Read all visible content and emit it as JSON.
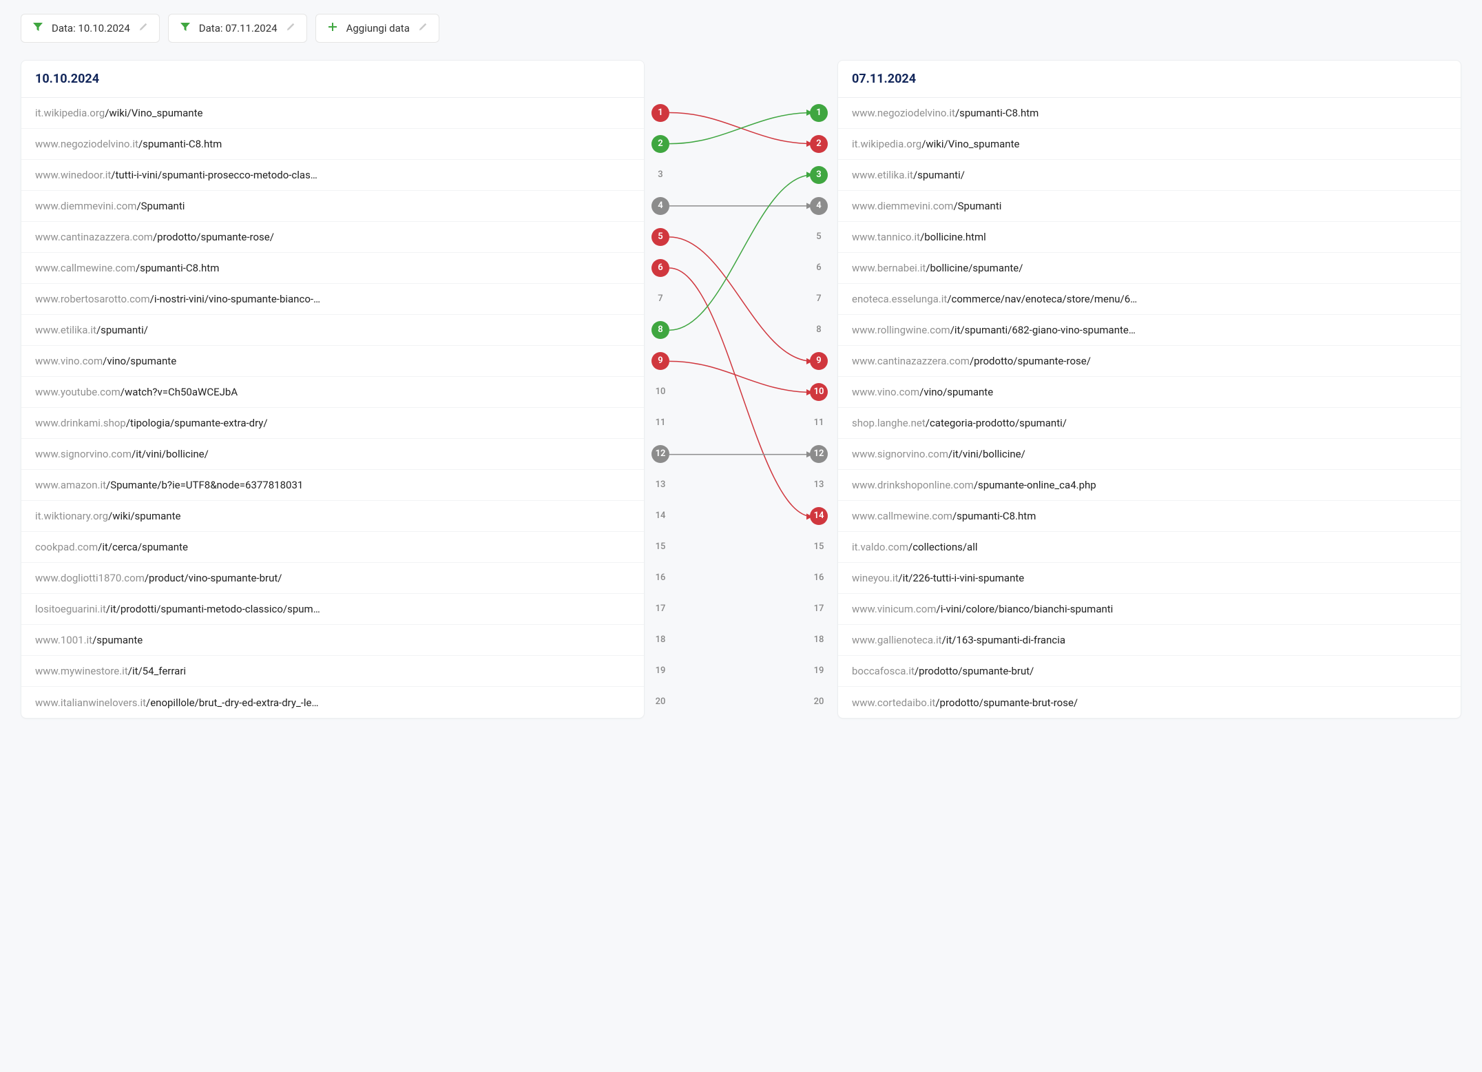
{
  "filters": {
    "date1_label": "Data: 10.10.2024",
    "date2_label": "Data: 07.11.2024",
    "add_label": "Aggiungi data"
  },
  "left": {
    "title": "10.10.2024",
    "rows": [
      {
        "domain": "it.wikipedia.org",
        "path": "/wiki/Vino_spumante"
      },
      {
        "domain": "www.negoziodelvino.it",
        "path": "/spumanti-C8.htm"
      },
      {
        "domain": "www.winedoor.it",
        "path": "/tutti-i-vini/spumanti-prosecco-metodo-clas…"
      },
      {
        "domain": "www.diemmevini.com",
        "path": "/Spumanti"
      },
      {
        "domain": "www.cantinazazzera.com",
        "path": "/prodotto/spumante-rose/"
      },
      {
        "domain": "www.callmewine.com",
        "path": "/spumanti-C8.htm"
      },
      {
        "domain": "www.robertosarotto.com",
        "path": "/i-nostri-vini/vino-spumante-bianco-…"
      },
      {
        "domain": "www.etilika.it",
        "path": "/spumanti/"
      },
      {
        "domain": "www.vino.com",
        "path": "/vino/spumante"
      },
      {
        "domain": "www.youtube.com",
        "path": "/watch?v=Ch50aWCEJbA"
      },
      {
        "domain": "www.drinkami.shop",
        "path": "/tipologia/spumante-extra-dry/"
      },
      {
        "domain": "www.signorvino.com",
        "path": "/it/vini/bollicine/"
      },
      {
        "domain": "www.amazon.it",
        "path": "/Spumante/b?ie=UTF8&node=6377818031"
      },
      {
        "domain": "it.wiktionary.org",
        "path": "/wiki/spumante"
      },
      {
        "domain": "cookpad.com",
        "path": "/it/cerca/spumante"
      },
      {
        "domain": "www.dogliotti1870.com",
        "path": "/product/vino-spumante-brut/"
      },
      {
        "domain": "lositoeguarini.it",
        "path": "/it/prodotti/spumanti-metodo-classico/spum…"
      },
      {
        "domain": "www.1001.it",
        "path": "/spumante"
      },
      {
        "domain": "www.mywinestore.it",
        "path": "/it/54_ferrari"
      },
      {
        "domain": "www.italianwinelovers.it",
        "path": "/enopillole/brut_-dry-ed-extra-dry_-le…"
      }
    ]
  },
  "right": {
    "title": "07.11.2024",
    "rows": [
      {
        "domain": "www.negoziodelvino.it",
        "path": "/spumanti-C8.htm"
      },
      {
        "domain": "it.wikipedia.org",
        "path": "/wiki/Vino_spumante"
      },
      {
        "domain": "www.etilika.it",
        "path": "/spumanti/"
      },
      {
        "domain": "www.diemmevini.com",
        "path": "/Spumanti"
      },
      {
        "domain": "www.tannico.it",
        "path": "/bollicine.html"
      },
      {
        "domain": "www.bernabei.it",
        "path": "/bollicine/spumante/"
      },
      {
        "domain": "enoteca.esselunga.it",
        "path": "/commerce/nav/enoteca/store/menu/6…"
      },
      {
        "domain": "www.rollingwine.com",
        "path": "/it/spumanti/682-giano-vino-spumante…"
      },
      {
        "domain": "www.cantinazazzera.com",
        "path": "/prodotto/spumante-rose/"
      },
      {
        "domain": "www.vino.com",
        "path": "/vino/spumante"
      },
      {
        "domain": "shop.langhe.net",
        "path": "/categoria-prodotto/spumanti/"
      },
      {
        "domain": "www.signorvino.com",
        "path": "/it/vini/bollicine/"
      },
      {
        "domain": "www.drinkshoponline.com",
        "path": "/spumante-online_ca4.php"
      },
      {
        "domain": "www.callmewine.com",
        "path": "/spumanti-C8.htm"
      },
      {
        "domain": "it.valdo.com",
        "path": "/collections/all"
      },
      {
        "domain": "wineyou.it",
        "path": "/it/226-tutti-i-vini-spumante"
      },
      {
        "domain": "www.vinicum.com",
        "path": "/i-vini/colore/bianco/bianchi-spumanti"
      },
      {
        "domain": "www.gallienoteca.it",
        "path": "/it/163-spumanti-di-francia"
      },
      {
        "domain": "boccafosca.it",
        "path": "/prodotto/spumante-brut/"
      },
      {
        "domain": "www.cortedaibo.it",
        "path": "/prodotto/spumante-brut-rose/"
      }
    ]
  },
  "badges": {
    "left": [
      {
        "n": "1",
        "c": "red"
      },
      {
        "n": "2",
        "c": "green"
      },
      {
        "n": "3",
        "c": "plain"
      },
      {
        "n": "4",
        "c": "gray"
      },
      {
        "n": "5",
        "c": "red"
      },
      {
        "n": "6",
        "c": "red"
      },
      {
        "n": "7",
        "c": "plain"
      },
      {
        "n": "8",
        "c": "green"
      },
      {
        "n": "9",
        "c": "red"
      },
      {
        "n": "10",
        "c": "plain"
      },
      {
        "n": "11",
        "c": "plain"
      },
      {
        "n": "12",
        "c": "gray"
      },
      {
        "n": "13",
        "c": "plain"
      },
      {
        "n": "14",
        "c": "plain"
      },
      {
        "n": "15",
        "c": "plain"
      },
      {
        "n": "16",
        "c": "plain"
      },
      {
        "n": "17",
        "c": "plain"
      },
      {
        "n": "18",
        "c": "plain"
      },
      {
        "n": "19",
        "c": "plain"
      },
      {
        "n": "20",
        "c": "plain"
      }
    ],
    "right": [
      {
        "n": "1",
        "c": "green"
      },
      {
        "n": "2",
        "c": "red"
      },
      {
        "n": "3",
        "c": "green"
      },
      {
        "n": "4",
        "c": "gray"
      },
      {
        "n": "5",
        "c": "plain"
      },
      {
        "n": "6",
        "c": "plain"
      },
      {
        "n": "7",
        "c": "plain"
      },
      {
        "n": "8",
        "c": "plain"
      },
      {
        "n": "9",
        "c": "red"
      },
      {
        "n": "10",
        "c": "red"
      },
      {
        "n": "11",
        "c": "plain"
      },
      {
        "n": "12",
        "c": "gray"
      },
      {
        "n": "13",
        "c": "plain"
      },
      {
        "n": "14",
        "c": "red"
      },
      {
        "n": "15",
        "c": "plain"
      },
      {
        "n": "16",
        "c": "plain"
      },
      {
        "n": "17",
        "c": "plain"
      },
      {
        "n": "18",
        "c": "plain"
      },
      {
        "n": "19",
        "c": "plain"
      },
      {
        "n": "20",
        "c": "plain"
      }
    ]
  },
  "connections": [
    {
      "from": 1,
      "to": 2,
      "c": "red"
    },
    {
      "from": 2,
      "to": 1,
      "c": "green"
    },
    {
      "from": 4,
      "to": 4,
      "c": "gray"
    },
    {
      "from": 5,
      "to": 9,
      "c": "red"
    },
    {
      "from": 6,
      "to": 14,
      "c": "red"
    },
    {
      "from": 8,
      "to": 3,
      "c": "green"
    },
    {
      "from": 9,
      "to": 10,
      "c": "red"
    },
    {
      "from": 12,
      "to": 12,
      "c": "gray"
    }
  ],
  "colors": {
    "red": "#d0373e",
    "green": "#3fa640",
    "gray": "#8c8c8c"
  }
}
